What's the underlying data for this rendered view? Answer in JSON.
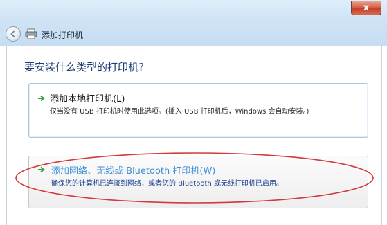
{
  "window": {
    "title": "添加打印机",
    "close_glyph": "x"
  },
  "page": {
    "heading": "要安装什么类型的打印机?"
  },
  "options": [
    {
      "title": "添加本地打印机(L)",
      "description": "仅当没有 USB 打印机时使用此选项。(插入 USB 打印机后，Windows 会自动安装。)"
    },
    {
      "title": "添加网络、无线或 Bluetooth 打印机(W)",
      "description": "确保您的计算机已连接到网络，或者您的 Bluetooth 或无线打印机已启用。"
    }
  ],
  "icons": {
    "back": "back-arrow-icon",
    "printer": "printer-icon",
    "option_arrow": "green-arrow-icon"
  },
  "colors": {
    "heading": "#1e3d73",
    "arrow": "#2f9e3a",
    "network_title": "#3f8fd6",
    "network_desc": "#1b3f8f",
    "annotation": "#d23a3a",
    "close_button": "#c3402a"
  }
}
